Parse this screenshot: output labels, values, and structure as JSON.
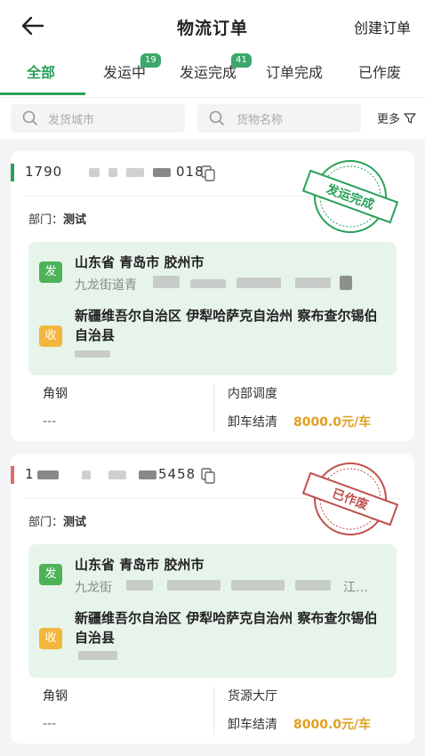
{
  "header": {
    "title": "物流订单",
    "create_label": "创建订单"
  },
  "tabs": [
    {
      "label": "全部",
      "active": true
    },
    {
      "label": "发运中",
      "badge": "19"
    },
    {
      "label": "发运完成",
      "badge": "41"
    },
    {
      "label": "订单完成"
    },
    {
      "label": "已作废"
    }
  ],
  "search": {
    "city_placeholder": "发货城市",
    "goods_placeholder": "货物名称",
    "more_label": "更多"
  },
  "orders": [
    {
      "order_prefix": "1790",
      "order_suffix": "018",
      "mark_color": "#2aa15a",
      "dept_label": "部门：",
      "dept_value": "测试",
      "status_stamp": "发运完成",
      "from_tag": "发",
      "from_city": "山东省 青岛市 胶州市",
      "from_addr": "九龙街道青",
      "to_tag": "收",
      "to_city": "新疆维吾尔自治区 伊犁哈萨克自治州 察布查尔锡伯自治县",
      "to_addr": "",
      "goods": "角钢",
      "goods_sub": "---",
      "source": "内部调度",
      "unload_label": "卸车结清",
      "price": "8000.0元/车"
    },
    {
      "order_prefix": "1",
      "order_suffix": "5458",
      "mark_color": "#e06a6a",
      "dept_label": "部门：",
      "dept_value": "测试",
      "status_stamp": "已作废",
      "from_tag": "发",
      "from_city": "山东省 青岛市 胶州市",
      "from_addr": "九龙街",
      "from_addr_tail": "江…",
      "to_tag": "收",
      "to_city": "新疆维吾尔自治区 伊犁哈萨克自治州 察布查尔锡伯自治县",
      "to_addr": "",
      "goods": "角钢",
      "goods_sub": "---",
      "source": "货源大厅",
      "unload_label": "卸车结清",
      "price": "8000.0元/车"
    }
  ],
  "colors": {
    "accent": "#2aa15a",
    "price": "#e0a020",
    "void": "#c0504d"
  }
}
